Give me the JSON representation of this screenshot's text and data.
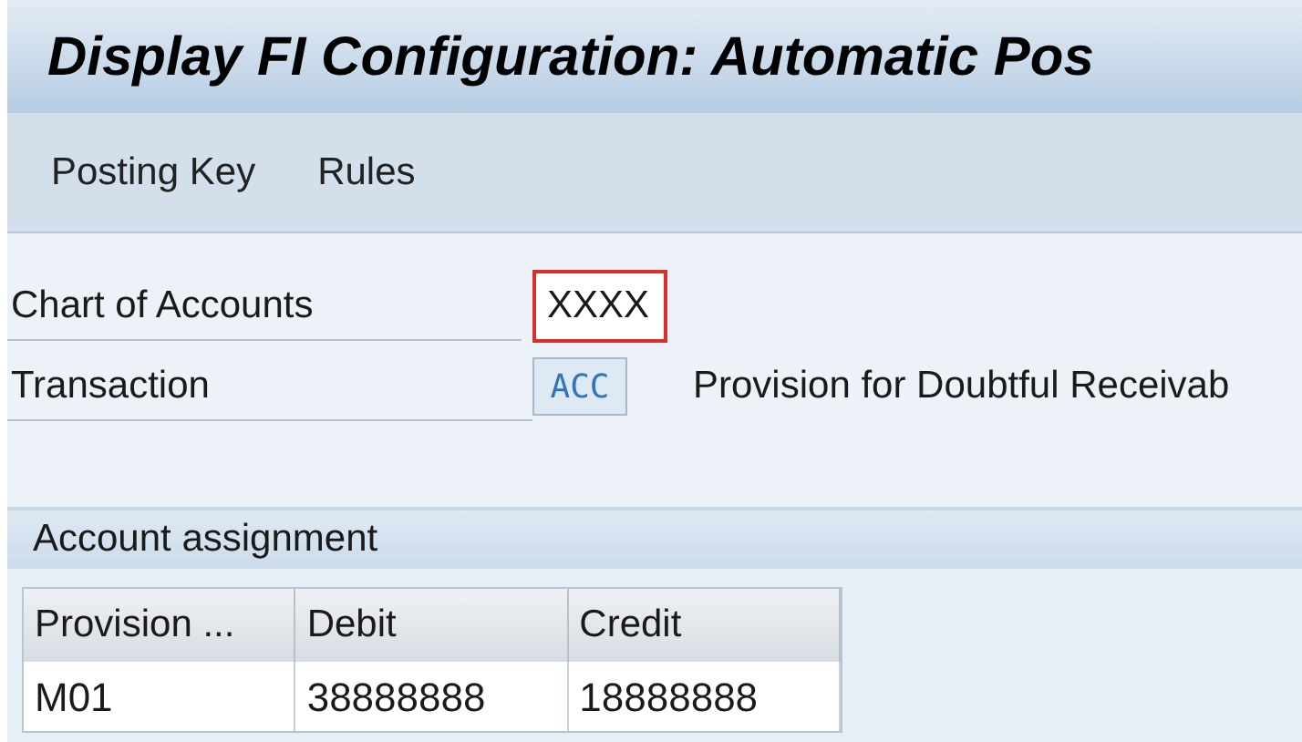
{
  "window": {
    "title": "Display FI Configuration: Automatic Pos"
  },
  "menu": [
    {
      "label": "Posting Key"
    },
    {
      "label": "Rules"
    }
  ],
  "fields": [
    {
      "label": "Chart of Accounts",
      "value": "XXXX",
      "focused": true
    },
    {
      "label": "Transaction",
      "value": "ACC",
      "description": "Provision for Doubtful Receivab"
    }
  ],
  "section": {
    "title": "Account assignment"
  },
  "table": {
    "columns": [
      "Provision ...",
      "Debit",
      "Credit"
    ],
    "rows": [
      [
        "M01",
        "38888888",
        "18888888"
      ]
    ]
  }
}
